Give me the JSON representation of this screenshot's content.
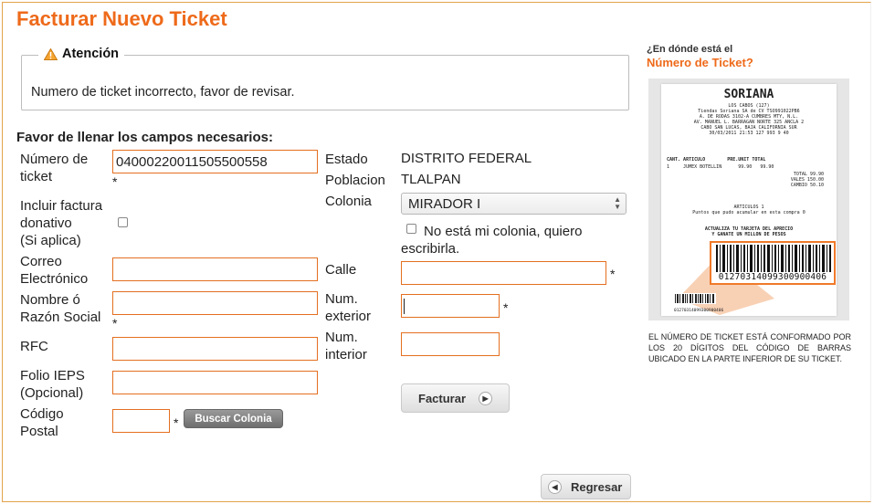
{
  "page": {
    "title": "Facturar Nuevo Ticket"
  },
  "alert": {
    "legend": "Atención",
    "message": "Numero de ticket incorrecto, favor de revisar."
  },
  "form": {
    "subtitle": "Favor de llenar los campos necesarios:",
    "ticket_label_1": "Número de",
    "ticket_label_2": "ticket",
    "ticket_value": "04000220011505500558",
    "donativo_label_1": "Incluir factura",
    "donativo_label_2": "donativo",
    "donativo_label_3": "(Si aplica)",
    "correo_label_1": "Correo",
    "correo_label_2": "Electrónico",
    "nombre_label_1": "Nombre ó",
    "nombre_label_2": "Razón Social",
    "rfc_label": "RFC",
    "folio_label_1": "Folio IEPS",
    "folio_label_2": "(Opcional)",
    "cp_label_1": "Código",
    "cp_label_2": "Postal",
    "required_mark": "*",
    "buscar_button": "Buscar Colonia",
    "estado_label": "Estado",
    "estado_value": "DISTRITO FEDERAL",
    "poblacion_label": "Poblacion",
    "poblacion_value": "TLALPAN",
    "colonia_label": "Colonia",
    "colonia_selected": "MIRADOR I",
    "no_colonia_label_1": "No está mi colonia, quiero",
    "no_colonia_label_2": "escribirla.",
    "calle_label": "Calle",
    "num_ext_label_1": "Num.",
    "num_ext_label_2": "exterior",
    "num_int_label_1": "Num.",
    "num_int_label_2": "interior",
    "facturar_button": "Facturar",
    "regresar_button": "Regresar"
  },
  "help": {
    "question": "¿En dónde está el",
    "title": "Número de Ticket?",
    "description": "El número de ticket está conformado por los 20 dígitos del código de barras ubicado en la parte inferior de su ticket.",
    "receipt": {
      "brand": "SORIANA",
      "store": "LOS CABOS (127)",
      "company": "Tiendas Soriana SA de CV TSO991022PB6",
      "address1": "A. DE RODAS 3102-A CUMBRES MTY, N.L.",
      "address2": "AV. MANUEL L. BARRAGAN NORTE 325 ANCLA 2",
      "address3": "CABO SAN LUCAS, BAJA CALIFORNIA SUR",
      "datetime": "30/03/2011 21:53 127 993 9 40",
      "cols": "CANT. ARTICULO        PRE.UNIT TOTAL",
      "line1": "1     JUMEX BOTELLIN      99.90   99.90",
      "total": "TOTAL   99.90",
      "vales": "VALES   150.00",
      "cambio": "CAMBIO   50.10",
      "articulos": "ARTICULOS 1",
      "puntos": "Puntos que pudo acumular en esta compra 0",
      "promo1": "ACTUALIZA TU TARJETA DEL APRECIO",
      "promo2": "Y GANATE UN MILLON DE PESOS",
      "barcode_big": "01270314099300900406",
      "barcode_small": "01270314099300900406"
    }
  },
  "colors": {
    "accent": "#ee6a1a",
    "input_border": "#e46f21"
  }
}
